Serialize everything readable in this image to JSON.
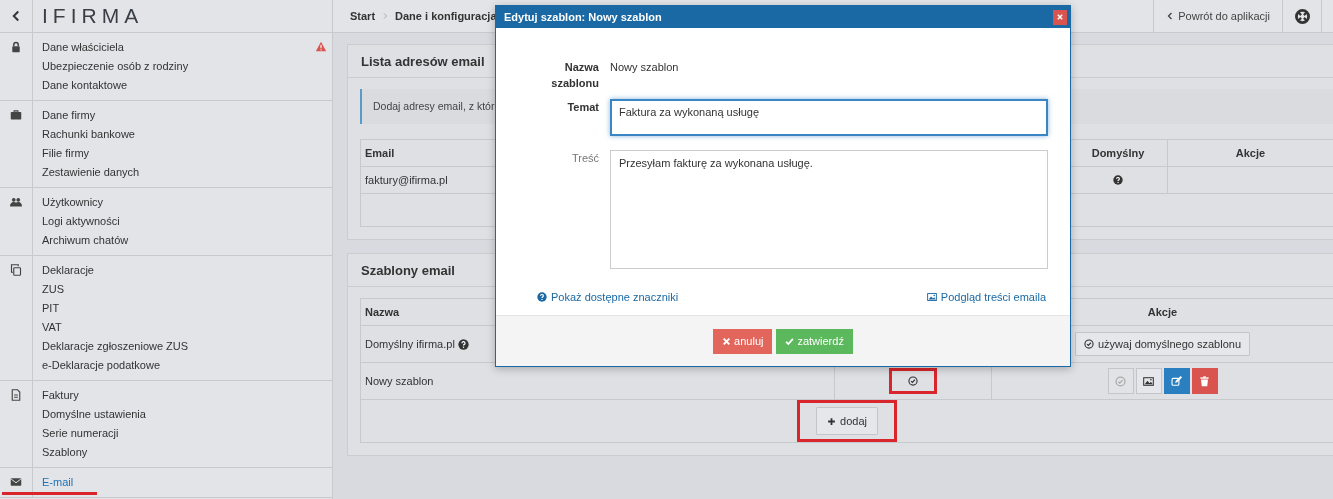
{
  "sidebar": {
    "logo": "IFIRMA",
    "groups": [
      {
        "items": [
          {
            "label": "Dane właściciela",
            "selected": false,
            "alert": true,
            "underlined": false
          },
          {
            "label": "Ubezpieczenie osób z rodziny",
            "selected": false,
            "alert": false,
            "underlined": false
          },
          {
            "label": "Dane kontaktowe",
            "selected": false,
            "alert": false,
            "underlined": false
          }
        ]
      },
      {
        "items": [
          {
            "label": "Dane firmy",
            "selected": false,
            "alert": false,
            "underlined": false
          },
          {
            "label": "Rachunki bankowe",
            "selected": false,
            "alert": false,
            "underlined": false
          },
          {
            "label": "Filie firmy",
            "selected": false,
            "alert": false,
            "underlined": false
          },
          {
            "label": "Zestawienie danych",
            "selected": false,
            "alert": false,
            "underlined": false
          }
        ]
      },
      {
        "items": [
          {
            "label": "Użytkownicy",
            "selected": false,
            "alert": false,
            "underlined": false
          },
          {
            "label": "Logi aktywności",
            "selected": false,
            "alert": false,
            "underlined": false
          },
          {
            "label": "Archiwum chatów",
            "selected": false,
            "alert": false,
            "underlined": false
          }
        ]
      },
      {
        "items": [
          {
            "label": "Deklaracje",
            "selected": false,
            "alert": false,
            "underlined": false
          },
          {
            "label": "ZUS",
            "selected": false,
            "alert": false,
            "underlined": false
          },
          {
            "label": "PIT",
            "selected": false,
            "alert": false,
            "underlined": false
          },
          {
            "label": "VAT",
            "selected": false,
            "alert": false,
            "underlined": false
          },
          {
            "label": "Deklaracje zgłoszeniowe ZUS",
            "selected": false,
            "alert": false,
            "underlined": false
          },
          {
            "label": "e-Deklaracje podatkowe",
            "selected": false,
            "alert": false,
            "underlined": false
          }
        ]
      },
      {
        "items": [
          {
            "label": "Faktury",
            "selected": false,
            "alert": false,
            "underlined": false
          },
          {
            "label": "Domyślne ustawienia",
            "selected": false,
            "alert": false,
            "underlined": false
          },
          {
            "label": "Serie numeracji",
            "selected": false,
            "alert": false,
            "underlined": false
          },
          {
            "label": "Szablony",
            "selected": false,
            "alert": false,
            "underlined": false
          }
        ]
      },
      {
        "items": [
          {
            "label": "E-mail",
            "selected": true,
            "alert": false,
            "underlined": true
          }
        ]
      }
    ]
  },
  "topbar": {
    "breadcrumb": [
      "Start",
      "Dane i konfiguracja"
    ],
    "back_link": "Powrót do aplikacji"
  },
  "panels": [
    {
      "title": "Lista adresów email",
      "note": "Dodaj adresy email, z któr",
      "columns": [
        {
          "label": "Email"
        },
        {
          "label": "Domyślny"
        },
        {
          "label": "Akcje"
        }
      ],
      "rows": [
        [
          {
            "kind": "text",
            "text": "faktury@ifirma.pl",
            "help": false
          },
          {
            "kind": "help-mark",
            "highlighted": false
          },
          {
            "kind": "empty"
          }
        ]
      ]
    },
    {
      "title": "Szablony email",
      "columns": [
        {
          "label": "Nazwa"
        },
        {},
        {
          "label": "Akcje"
        }
      ],
      "rows": [
        [
          {
            "kind": "text",
            "text": "Domyślny ifirma.pl",
            "help": true
          },
          {
            "kind": "empty"
          },
          {
            "kind": "button",
            "text": "używaj domyślnego szablonu",
            "highlighted": false
          }
        ],
        [
          {
            "kind": "text",
            "text": "Nowy szablon",
            "help": false
          },
          {
            "kind": "default-mark",
            "highlighted": true
          },
          {
            "kind": "actions",
            "highlighted": false,
            "actions": [
              {
                "kind": "set-default",
                "disabled": true
              },
              {
                "kind": "preview",
                "disabled": false
              },
              {
                "kind": "edit",
                "disabled": false
              },
              {
                "kind": "delete",
                "disabled": false
              }
            ]
          }
        ]
      ],
      "add_button": {
        "label": "dodaj",
        "highlighted": true
      }
    }
  ],
  "dialog": {
    "title": "Edytuj szablon: Nowy szablon",
    "fields": [
      {
        "kind": "static",
        "label": "Nazwa szablonu",
        "value": "Nowy szablon"
      },
      {
        "kind": "textarea",
        "label": "Temat",
        "value": "Faktura za wykonaną usługę",
        "focused": true
      },
      {
        "kind": "textarea",
        "label": "Treść",
        "value": "Przesyłam fakturę za wykonana usługę.",
        "focused": false
      }
    ],
    "links": [
      "Pokaż dostępne znaczniki",
      "Podgląd treści emaila"
    ],
    "buttons": [
      {
        "kind": "cancel",
        "label": "anuluj"
      },
      {
        "kind": "confirm",
        "label": "zatwierdź"
      }
    ]
  }
}
